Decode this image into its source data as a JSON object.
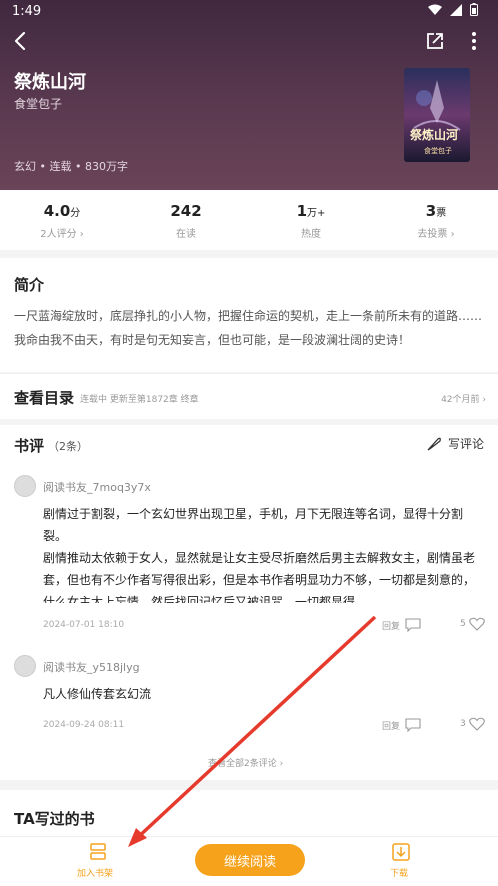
{
  "status": {
    "time": "1:49"
  },
  "book": {
    "title": "祭炼山河",
    "author": "食堂包子",
    "meta": "玄幻 • 连载 • 830万字",
    "cover_title": "祭炼山河",
    "cover_author": "食堂包子"
  },
  "stats": [
    {
      "value": "4.0",
      "unit": "分",
      "label": "2人评分 ›"
    },
    {
      "value": "242",
      "unit": "",
      "label": "在读"
    },
    {
      "value": "1",
      "unit": "万+",
      "label": "热度"
    },
    {
      "value": "3",
      "unit": "票",
      "label": "去投票 ›"
    }
  ],
  "intro": {
    "heading": "简介",
    "text": "一尺蓝海绽放时，底层挣扎的小人物，把握住命运的契机，走上一条前所未有的道路……我命由我不由天，有时是句无知妄言，但也可能，是一段波澜壮阔的史诗！"
  },
  "toc": {
    "heading": "查看目录",
    "status": "连载中 更新至第1872章 终章",
    "time": "42个月前 ›"
  },
  "reviews": {
    "heading": "书评",
    "count": "（2条）",
    "write_label": "写评论",
    "items": [
      {
        "user": "阅读书友_7moq3y7x",
        "text": "剧情过于割裂，一个玄幻世界出现卫星，手机，月下无限连等名词，显得十分割裂。\n剧情推动太依赖于女人，显然就是让女主受尽折磨然后男主去解救女主，剧情虽老套，但也有不少作者写得很出彩，但是本书作者明显功力不够，一切都是刻意的，什么女主太上忘情，然后找回记忆后又被诅咒，一切都显得…",
        "date": "2024-07-01 18:10",
        "reply": "回复",
        "likes": "5"
      },
      {
        "user": "阅读书友_y518jlyg",
        "text": "凡人修仙传套玄幻流",
        "date": "2024-09-24 08:11",
        "reply": "回复",
        "likes": "3"
      }
    ],
    "view_all": "查看全部2条评论 ›"
  },
  "ta_books": {
    "heading": "TA写过的书"
  },
  "bottom": {
    "shelf_label": "加入书架",
    "read_label": "继续阅读",
    "download_label": "下载"
  },
  "colors": {
    "accent": "#f7a21b",
    "header": "#4d3048",
    "annotation_arrow": "#e53a2c"
  }
}
